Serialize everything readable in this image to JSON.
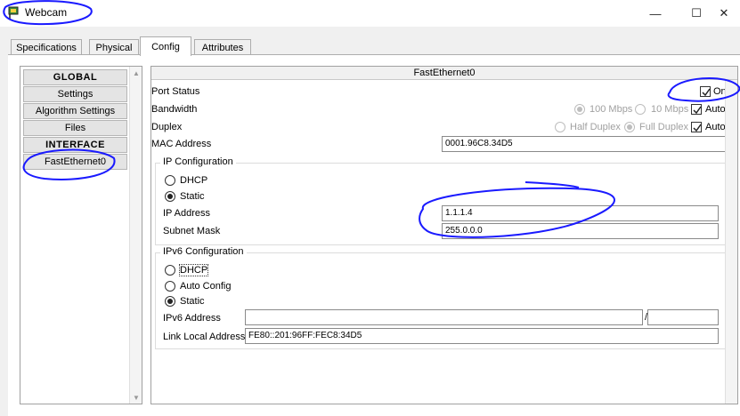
{
  "window": {
    "title": "Webcam",
    "minimize_glyph": "—",
    "maximize_glyph": "☐",
    "close_glyph": "✕",
    "icon": "webcam-app-icon"
  },
  "tabs": [
    {
      "label": "Specifications",
      "active": false
    },
    {
      "label": "Physical",
      "active": false
    },
    {
      "label": "Config",
      "active": true
    },
    {
      "label": "Attributes",
      "active": false
    }
  ],
  "nav": {
    "items": [
      {
        "label": "GLOBAL",
        "type": "header"
      },
      {
        "label": "Settings",
        "type": "item"
      },
      {
        "label": "Algorithm Settings",
        "type": "item"
      },
      {
        "label": "Files",
        "type": "item"
      },
      {
        "label": "INTERFACE",
        "type": "header"
      },
      {
        "label": "FastEthernet0",
        "type": "item"
      }
    ],
    "scroll_up_glyph": "▲",
    "scroll_down_glyph": "▼"
  },
  "panel": {
    "title": "FastEthernet0",
    "port_status": {
      "label": "Port Status",
      "checkbox_label": "On",
      "checked": true
    },
    "bandwidth": {
      "label": "Bandwidth",
      "opt1": "100 Mbps",
      "opt2": "10 Mbps",
      "auto_label": "Auto",
      "auto_checked": true
    },
    "duplex": {
      "label": "Duplex",
      "opt1": "Half Duplex",
      "opt2": "Full Duplex",
      "auto_label": "Auto",
      "auto_checked": true
    },
    "mac": {
      "label": "MAC Address",
      "value": "0001.96C8.34D5"
    },
    "ipv4": {
      "title": "IP Configuration",
      "dhcp_label": "DHCP",
      "static_label": "Static",
      "mode": "static",
      "ip_label": "IP Address",
      "ip_value": "1.1.1.4",
      "mask_label": "Subnet Mask",
      "mask_value": "255.0.0.0"
    },
    "ipv6": {
      "title": "IPv6 Configuration",
      "dhcp_label": "DHCP",
      "auto_label": "Auto Config",
      "static_label": "Static",
      "mode": "static",
      "address_label": "IPv6 Address",
      "address_value": "",
      "separator": "/",
      "prefix_value": "",
      "link_local_label": "Link Local Address:",
      "link_local_value": "FE80::201:96FF:FEC8:34D5"
    }
  },
  "colors": {
    "annotation": "#1a1aff",
    "window_bg": "#f0f0f0",
    "content_bg": "#ffffff",
    "disabled_text": "#a0a0a0"
  }
}
